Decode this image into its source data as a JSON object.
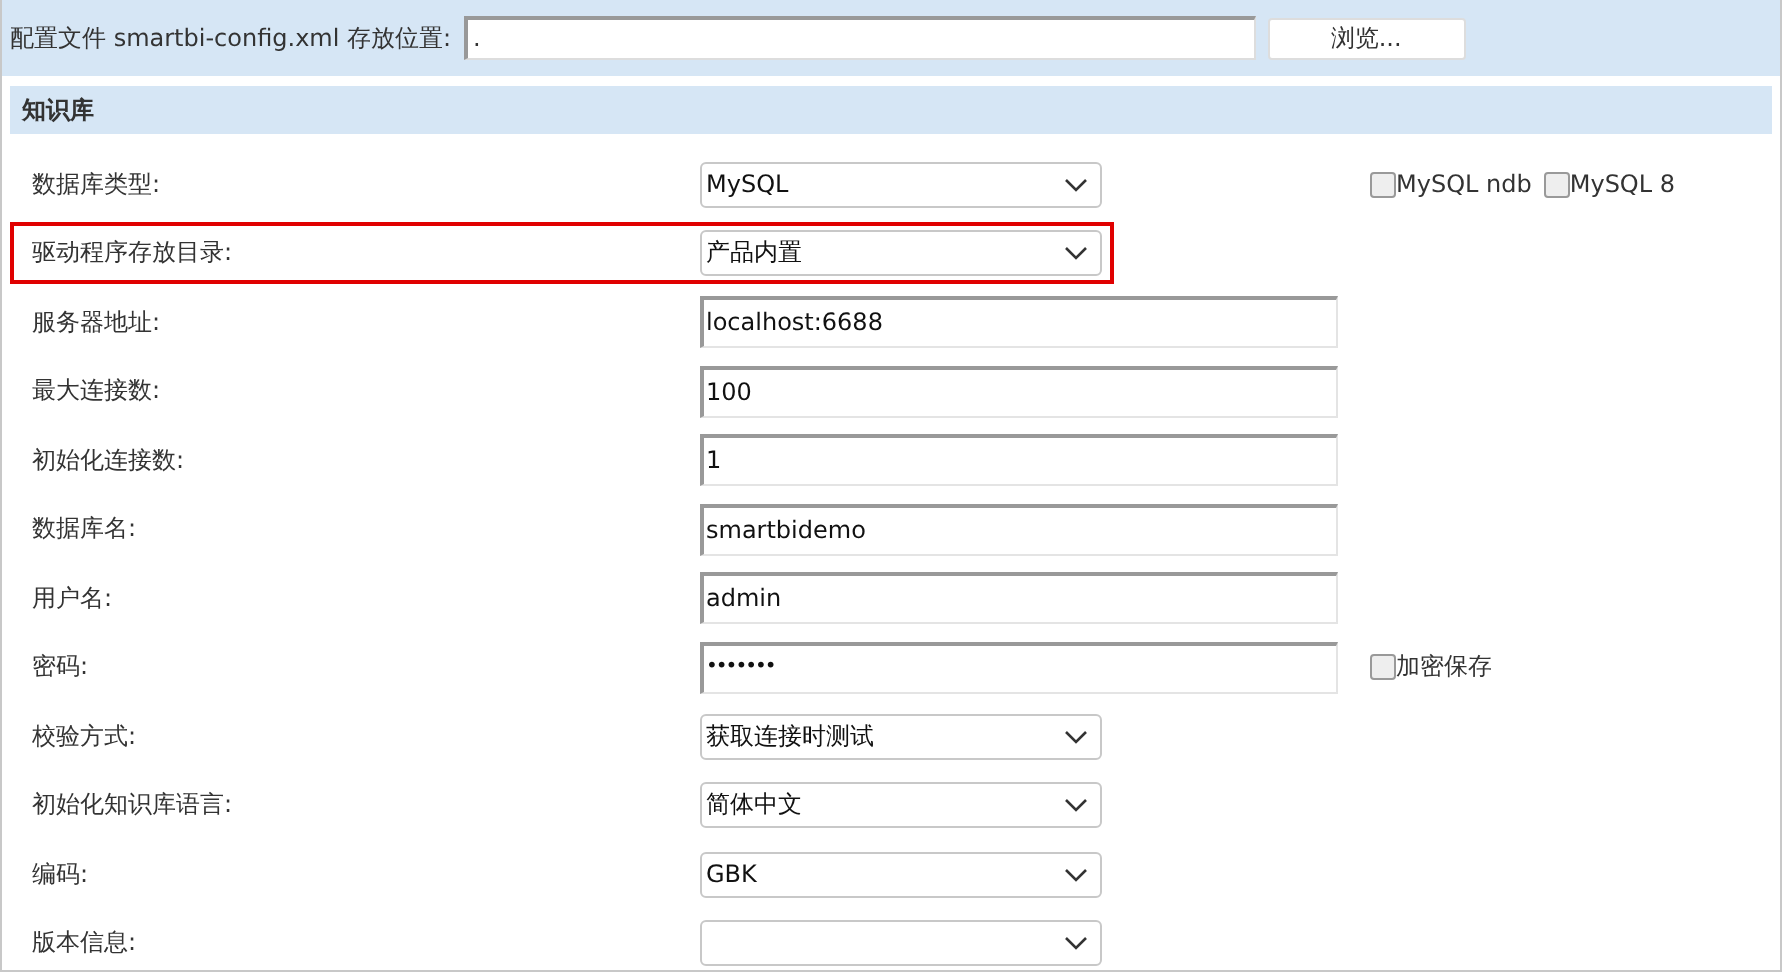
{
  "config_bar": {
    "label": "配置文件 smartbi-config.xml 存放位置:",
    "path_value": ".",
    "browse_button": "浏览..."
  },
  "section": {
    "title": "知识库"
  },
  "rows": [
    {
      "label": "数据库类型:",
      "kind": "select",
      "value": "MySQL",
      "highlighted": false,
      "options": [
        {
          "label": "MySQL ndb",
          "checked": false
        },
        {
          "label": "MySQL 8",
          "checked": false
        }
      ]
    },
    {
      "label": "驱动程序存放目录:",
      "kind": "select",
      "value": "产品内置",
      "highlighted": true
    },
    {
      "label": "服务器地址:",
      "kind": "input",
      "value": "localhost:6688",
      "highlighted": false
    },
    {
      "label": "最大连接数:",
      "kind": "input",
      "value": "100",
      "highlighted": false
    },
    {
      "label": "初始化连接数:",
      "kind": "input",
      "value": "1",
      "highlighted": false
    },
    {
      "label": "数据库名:",
      "kind": "input",
      "value": "smartbidemo",
      "highlighted": false
    },
    {
      "label": "用户名:",
      "kind": "input",
      "value": "admin",
      "highlighted": false
    },
    {
      "label": "密码:",
      "kind": "password",
      "value": "•••••••",
      "highlighted": false,
      "options": [
        {
          "label": "加密保存",
          "checked": false
        }
      ]
    },
    {
      "label": "校验方式:",
      "kind": "select",
      "value": "获取连接时测试",
      "highlighted": false
    },
    {
      "label": "初始化知识库语言:",
      "kind": "select",
      "value": "简体中文",
      "highlighted": false
    },
    {
      "label": "编码:",
      "kind": "select",
      "value": "GBK",
      "highlighted": false
    },
    {
      "label": "版本信息:",
      "kind": "select",
      "highlighted": false
    }
  ]
}
